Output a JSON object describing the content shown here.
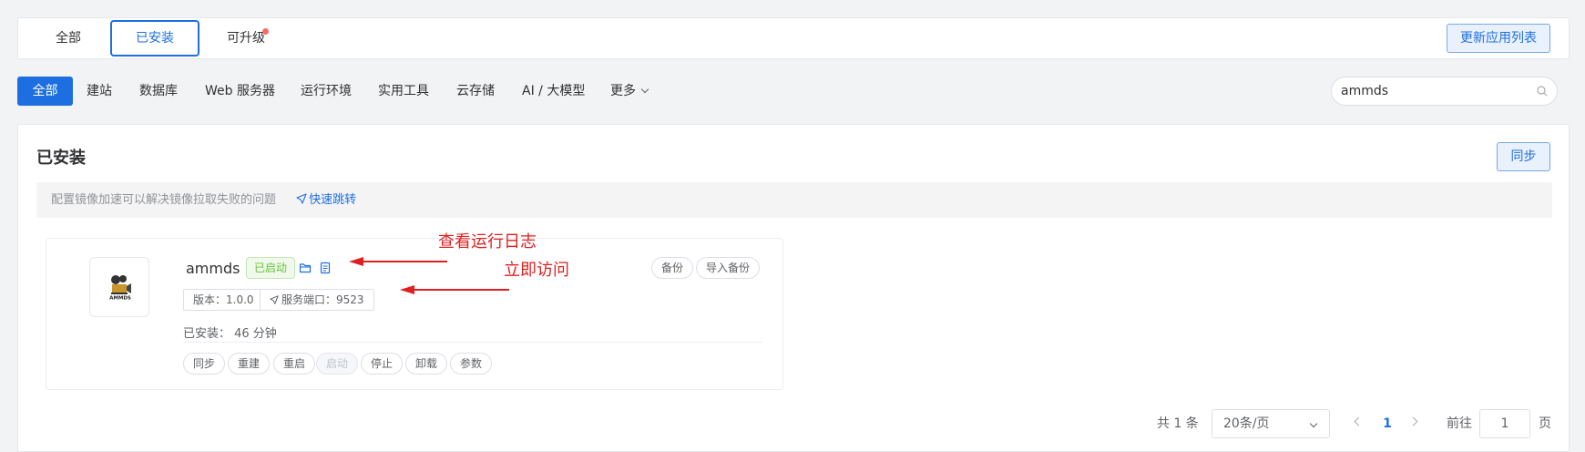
{
  "top_tabs": [
    "全部",
    "已安装",
    "可升级"
  ],
  "update_button": "更新应用列表",
  "categories": [
    "全部",
    "建站",
    "数据库",
    "Web 服务器",
    "运行环境",
    "实用工具",
    "云存储",
    "AI / 大模型",
    "更多"
  ],
  "search": {
    "value": "ammds",
    "icon": "search-icon"
  },
  "panel": {
    "title": "已安装",
    "sync_button": "同步",
    "notice_text": "配置镜像加速可以解决镜像拉取失败的问题",
    "notice_link": "快速跳转"
  },
  "app": {
    "name": "ammds",
    "logo_text": "AMMDS",
    "status": "已启动",
    "version": "版本：1.0.0",
    "port": "服务端口：9523",
    "installed": "已安装： 46 分钟",
    "backup_buttons": [
      "备份",
      "导入备份"
    ],
    "actions": [
      "同步",
      "重建",
      "重启",
      "启动",
      "停止",
      "卸载",
      "参数"
    ]
  },
  "annotations": [
    "查看运行日志",
    "立即访问"
  ],
  "pagination": {
    "total": "共 1 条",
    "page_size": "20条/页",
    "current_page": "1",
    "goto_label": "前往",
    "goto_value": "1",
    "page_suffix": "页"
  },
  "colors": {
    "primary": "#1d6fe1",
    "success": "#67c23a",
    "annotation": "#e02020",
    "dot": "#f56c6c"
  }
}
